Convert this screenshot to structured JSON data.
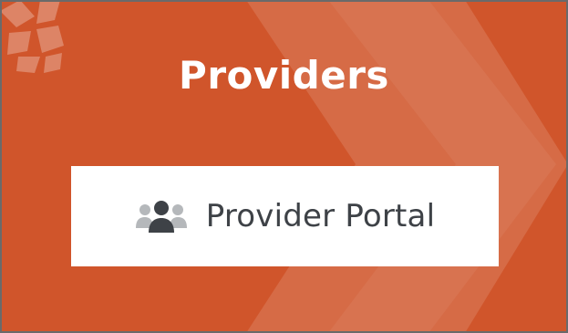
{
  "card": {
    "title": "Providers",
    "background_color": "#d0552b"
  },
  "portal_button": {
    "label": "Provider Portal",
    "icon": "users-group-icon",
    "text_color": "#3e4247"
  }
}
